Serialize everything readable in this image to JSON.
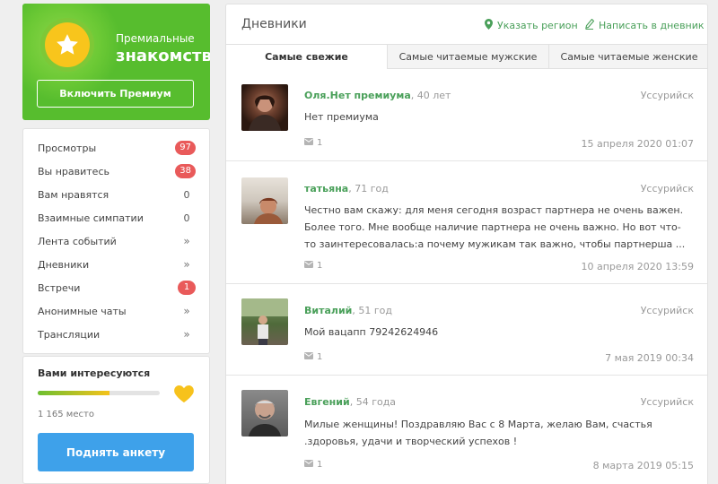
{
  "premium": {
    "line1": "Премиальные",
    "line2": "знакомства",
    "button": "Включить Премиум"
  },
  "menu": [
    {
      "label": "Просмотры",
      "value": "97",
      "kind": "badge"
    },
    {
      "label": "Вы нравитесь",
      "value": "38",
      "kind": "badge"
    },
    {
      "label": "Вам нравятся",
      "value": "0",
      "kind": "plain"
    },
    {
      "label": "Взаимные симпатии",
      "value": "0",
      "kind": "plain"
    },
    {
      "label": "Лента событий",
      "value": "»",
      "kind": "arrow"
    },
    {
      "label": "Дневники",
      "value": "»",
      "kind": "arrow"
    },
    {
      "label": "Встречи",
      "value": "1",
      "kind": "badge"
    },
    {
      "label": "Анонимные чаты",
      "value": "»",
      "kind": "arrow"
    },
    {
      "label": "Трансляции",
      "value": "»",
      "kind": "arrow"
    }
  ],
  "interest": {
    "title": "Вами интересуются",
    "progress": 0.59,
    "place": "1 165 место",
    "button": "Поднять анкету"
  },
  "diaries": {
    "title": "Дневники",
    "region_link": "Указать регион",
    "write_link": "Написать в дневник",
    "tabs": [
      "Самые свежие",
      "Самые читаемые мужские",
      "Самые читаемые женские"
    ],
    "entries": [
      {
        "name": "Оля.Нет премиума",
        "age": ", 40 лет",
        "city": "Уссурийск",
        "text": "Нет премиума",
        "comments": "1",
        "date": "15 апреля 2020 01:07"
      },
      {
        "name": "татьяна",
        "age": ", 71 год",
        "city": "Уссурийск",
        "text": "Честно вам скажу: для меня сегодня возраст партнера не очень важен. Более того. Мне вообще наличие партнера не очень важно. Но вот что-то заинтересовалась:а почему мужикам так важно, чтобы партнерша ...",
        "comments": "1",
        "date": "10 апреля 2020 13:59"
      },
      {
        "name": "Виталий",
        "age": ", 51 год",
        "city": "Уссурийск",
        "text": "Мой вацапп 79242624946",
        "comments": "1",
        "date": "7 мая 2019 00:34"
      },
      {
        "name": "Евгений",
        "age": ", 54 года",
        "city": "Уссурийск",
        "text": "Милые женщины! Поздравляю Вас с 8 Марта, желаю Вам, счастья .здоровья, удачи и творческий успехов !",
        "comments": "1",
        "date": "8 марта 2019 05:15"
      }
    ]
  },
  "colors": {
    "brand_green": "#57bd2e",
    "link_green": "#4aa05a",
    "badge_red": "#e95a5a",
    "button_blue": "#3ea1ea",
    "star_yellow": "#f8c51c"
  }
}
